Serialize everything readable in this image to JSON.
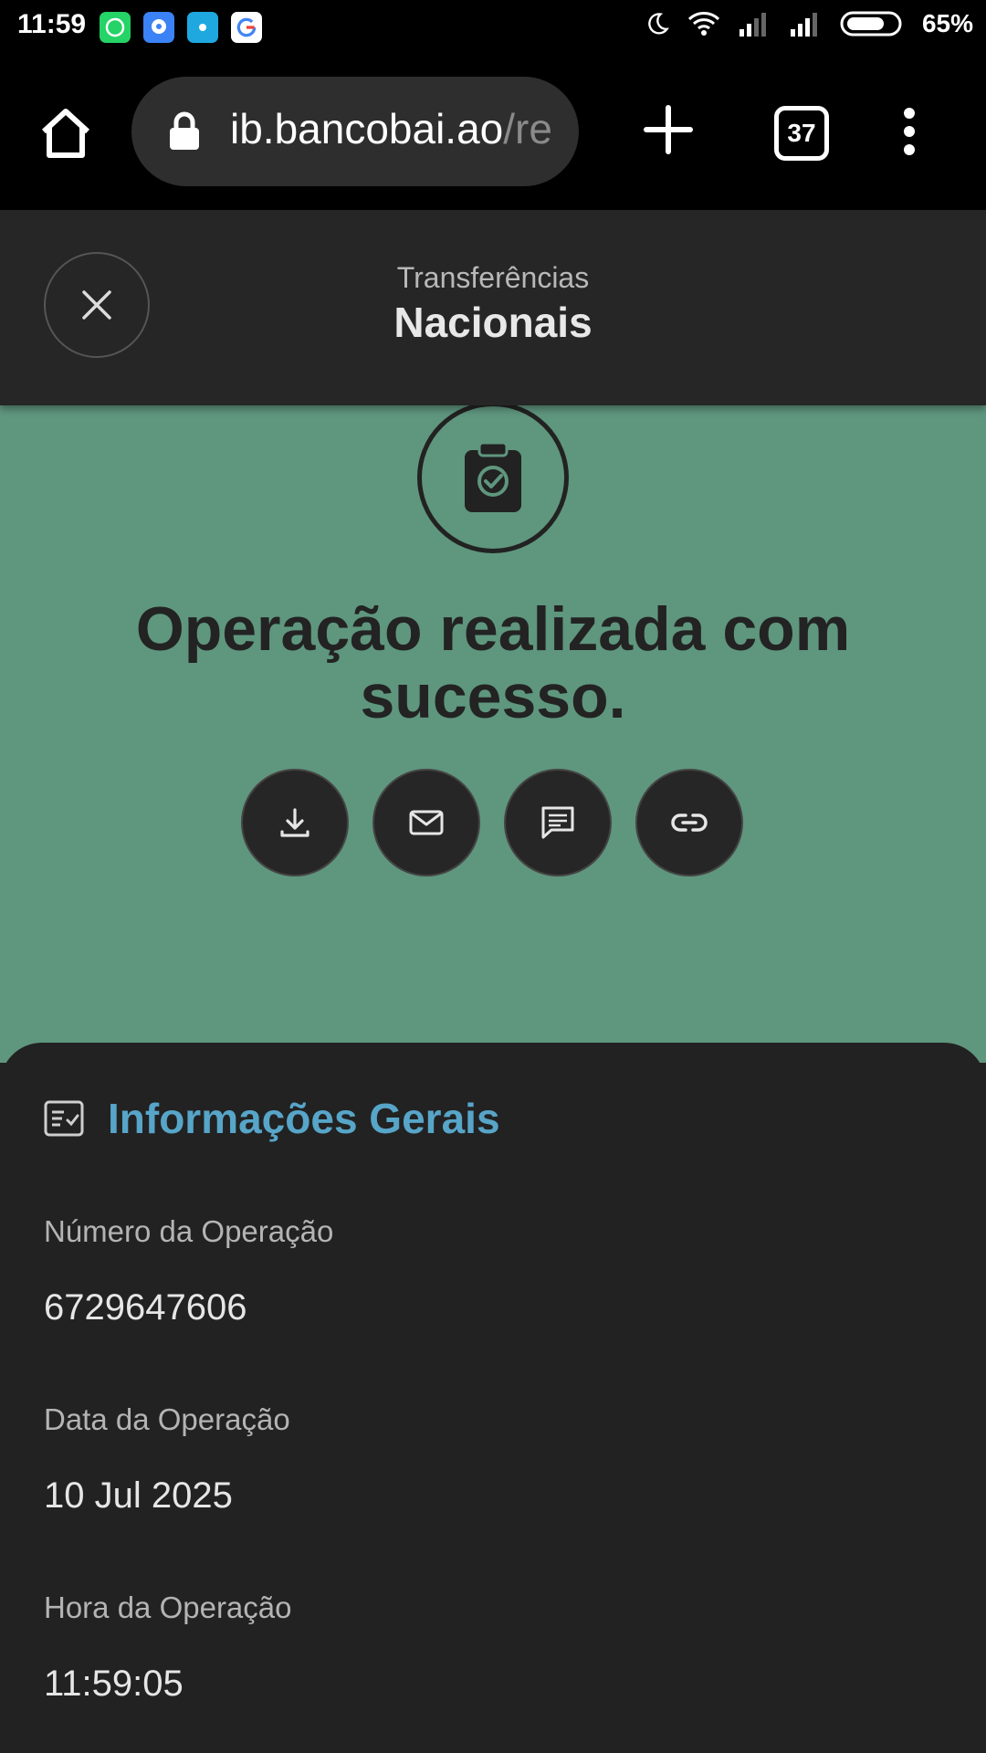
{
  "status_bar": {
    "time": "11:59",
    "battery": "65%",
    "notification_icons": [
      "whatsapp-icon",
      "messenger-icon",
      "app-icon",
      "google-icon"
    ]
  },
  "browser": {
    "url_main": "ib.bancobai.ao",
    "url_rest": "/re",
    "tab_count": "37"
  },
  "header": {
    "subtitle": "Transferências",
    "title": "Nacionais"
  },
  "success": {
    "message": "Operação realizada com sucesso.",
    "actions": [
      "download-icon",
      "email-icon",
      "message-icon",
      "link-icon"
    ]
  },
  "info": {
    "section_title": "Informações Gerais",
    "fields": [
      {
        "label": "Número da Operação",
        "value": "6729647606"
      },
      {
        "label": "Data da Operação",
        "value": "10 Jul 2025"
      },
      {
        "label": "Hora da Operação",
        "value": "11:59:05"
      }
    ]
  },
  "colors": {
    "success_background": "#5f967e",
    "section_title": "#57a5c8",
    "card_background": "#222222"
  }
}
